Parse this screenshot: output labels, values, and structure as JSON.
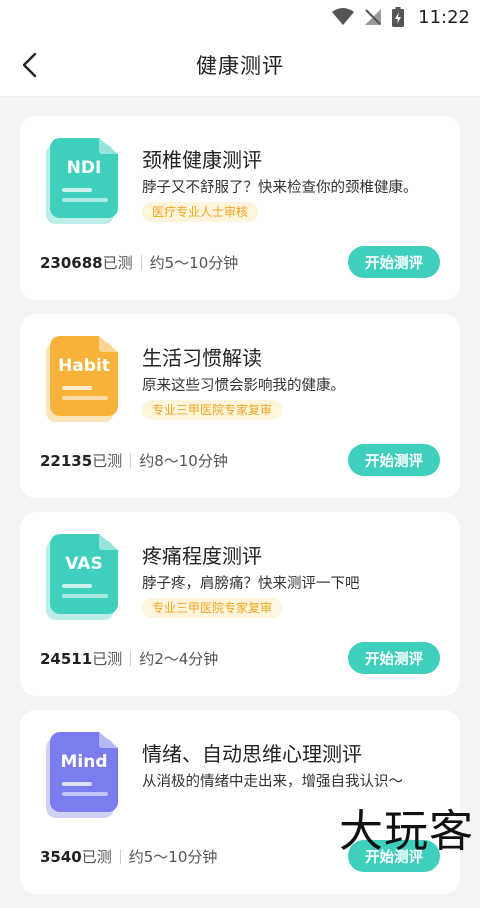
{
  "status": {
    "time": "11:22"
  },
  "nav": {
    "title": "健康测评"
  },
  "colors": {
    "teal": "#3ecfbd",
    "orange": "#f7b23a",
    "purple": "#7b7cf0",
    "badge_text": "#f0a820"
  },
  "cards": [
    {
      "icon_text": "NDI",
      "icon_color": "#3ecfbd",
      "title": "颈椎健康测评",
      "desc": "脖子又不舒服了？快来检查你的颈椎健康。",
      "badge": "医疗专业人士审核",
      "count": "230688",
      "count_suffix": "已测",
      "duration": "约5～10分钟",
      "button": "开始测评"
    },
    {
      "icon_text": "Habit",
      "icon_color": "#f7b23a",
      "title": "生活习惯解读",
      "desc": "原来这些习惯会影响我的健康。",
      "badge": "专业三甲医院专家复审",
      "count": "22135",
      "count_suffix": "已测",
      "duration": "约8～10分钟",
      "button": "开始测评"
    },
    {
      "icon_text": "VAS",
      "icon_color": "#3ecfbd",
      "title": "疼痛程度测评",
      "desc": "脖子疼，肩膀痛？快来测评一下吧",
      "badge": "专业三甲医院专家复审",
      "count": "24511",
      "count_suffix": "已测",
      "duration": "约2～4分钟",
      "button": "开始测评"
    },
    {
      "icon_text": "Mind",
      "icon_color": "#7b7cf0",
      "title": "情绪、自动思维心理测评",
      "desc": "从消极的情绪中走出来，增强自我认识～",
      "badge": "",
      "count": "3540",
      "count_suffix": "已测",
      "duration": "约5～10分钟",
      "button": "开始测评"
    }
  ],
  "watermark": "大玩客"
}
